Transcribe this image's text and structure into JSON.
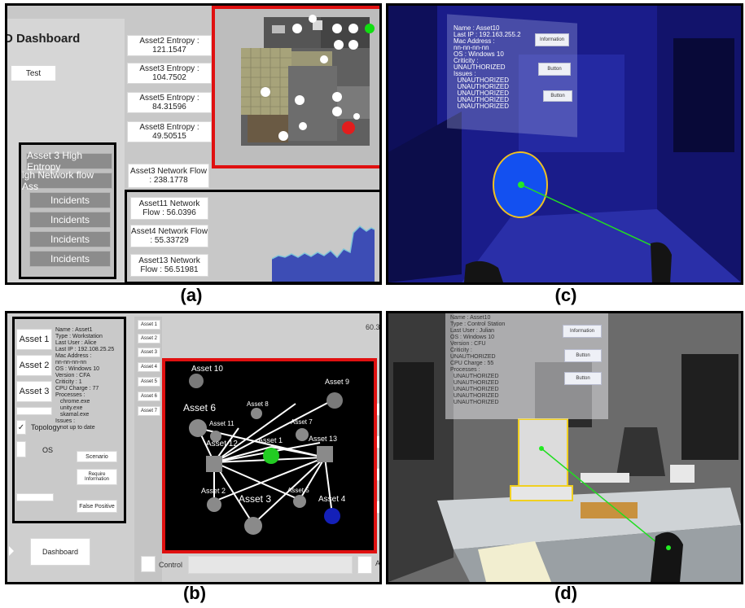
{
  "captions": {
    "a": "(a)",
    "b": "(b)",
    "c": "(c)",
    "d": "(d)"
  },
  "panel_a": {
    "title": "D Dashboard",
    "test_button": "Test",
    "entropy": [
      "Asset2 Entropy : 121.1547",
      "Asset3 Entropy : 104.7502",
      "Asset5 Entropy : 84.31596",
      "Asset8 Entropy : 49.50515"
    ],
    "flows": [
      "Asset3 Network Flow : 238.1778",
      "Asset11 Network Flow : 56.0396",
      "Asset4 Network Flow : 55.33729",
      "Asset13 Network Flow : 56.51981"
    ],
    "alerts": [
      "Asset 3 High Entropy",
      "igh Network flow Ass",
      "Incidents",
      "Incidents",
      "Incidents",
      "Incidents"
    ]
  },
  "panel_b": {
    "assets": [
      "Asset 1",
      "Asset 2",
      "Asset 3"
    ],
    "info": "Name : Asset1\nType : Workstation\nLast User : Alice\nLast IP : 192.108.25.25\nMac Address :\nnn-nn-nn-nn\nOS : Windows 10\nVersion : CFA\nCriticity : 1\nCPU Charge : 77\nProcesses :\n   chrome.exe\n   unity.exe\n   skamal.exe\nIssues :\n   not up to date",
    "topology_label": "Topology",
    "os_label": "OS",
    "scenario_button": "Scenario",
    "require_button": "Require\nInformation",
    "false_positive_button": "False Positive",
    "dashboard_button": "Dashboard",
    "tabs": [
      "Asset 1",
      "Asset 2",
      "Asset 3",
      "Asset 4",
      "Asset 5",
      "Asset 6",
      "Asset 7"
    ],
    "top_right_value": "60.3",
    "control_label": "Control",
    "right_edge_letter": "A",
    "graph_labels": [
      "Asset 10",
      "Asset 9",
      "Asset 6",
      "Asset 8",
      "Asset 11",
      "Asset 7",
      "Asset 12",
      "Asset 1",
      "Asset 13",
      "Asset 2",
      "Asset 3",
      "Asset 5",
      "Asset 4"
    ]
  },
  "panel_c": {
    "info": "Name : Asset10\nLast IP : 192.163.255.2\nMac Address :\nnn-nn-nn-nn\nOS : Windows 10\nCriticity :\nUNAUTHORIZED\nIssues :\n  UNAUTHORIZED\n  UNAUTHORIZED\n  UNAUTHORIZED\n  UNAUTHORIZED\n  UNAUTHORIZED",
    "buttons": [
      "Information",
      "Button",
      "Button"
    ]
  },
  "panel_d": {
    "info": "Name : Asset10\nType : Control Station\nLast User : Julian\nOS : Windows 10\nVersion : CFU\nCriticity :\nUNAUTHORIZED\nCPU Charge : 55\nProcesses :\n  UNAUTHORIZED\n  UNAUTHORIZED\n  UNAUTHORIZED\n  UNAUTHORIZED\n  UNAUTHORIZED",
    "buttons": [
      "Information",
      "Button",
      "Button"
    ]
  }
}
